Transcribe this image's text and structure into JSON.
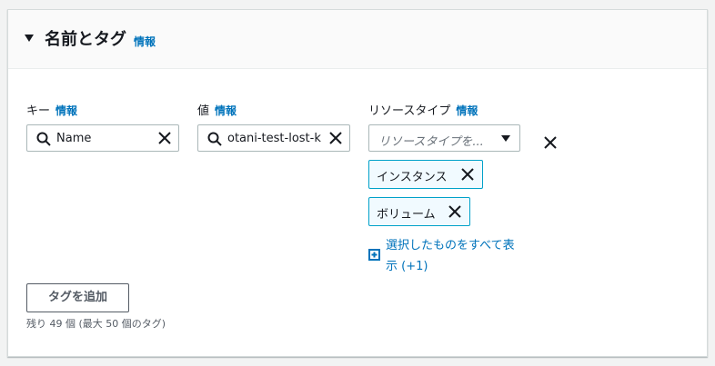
{
  "section": {
    "title": "名前とタグ",
    "info": "情報"
  },
  "fields": {
    "key": {
      "label": "キー",
      "info": "情報",
      "value": "Name"
    },
    "value": {
      "label": "値",
      "info": "情報",
      "value": "otani-test-lost-k"
    },
    "resource_type": {
      "label": "リソースタイプ",
      "info": "情報",
      "placeholder": "リソースタイプを...",
      "selected_tokens": [
        "インスタンス",
        "ボリューム"
      ],
      "show_all_label": "選択したものをすべて表示 (+1)"
    }
  },
  "actions": {
    "add_tag": "タグを追加",
    "remaining_hint": "残り 49 個 (最大 50 個のタグ)"
  },
  "colors": {
    "link": "#0073bb",
    "token_bg": "#f1faff",
    "token_border": "#00a1c9"
  }
}
